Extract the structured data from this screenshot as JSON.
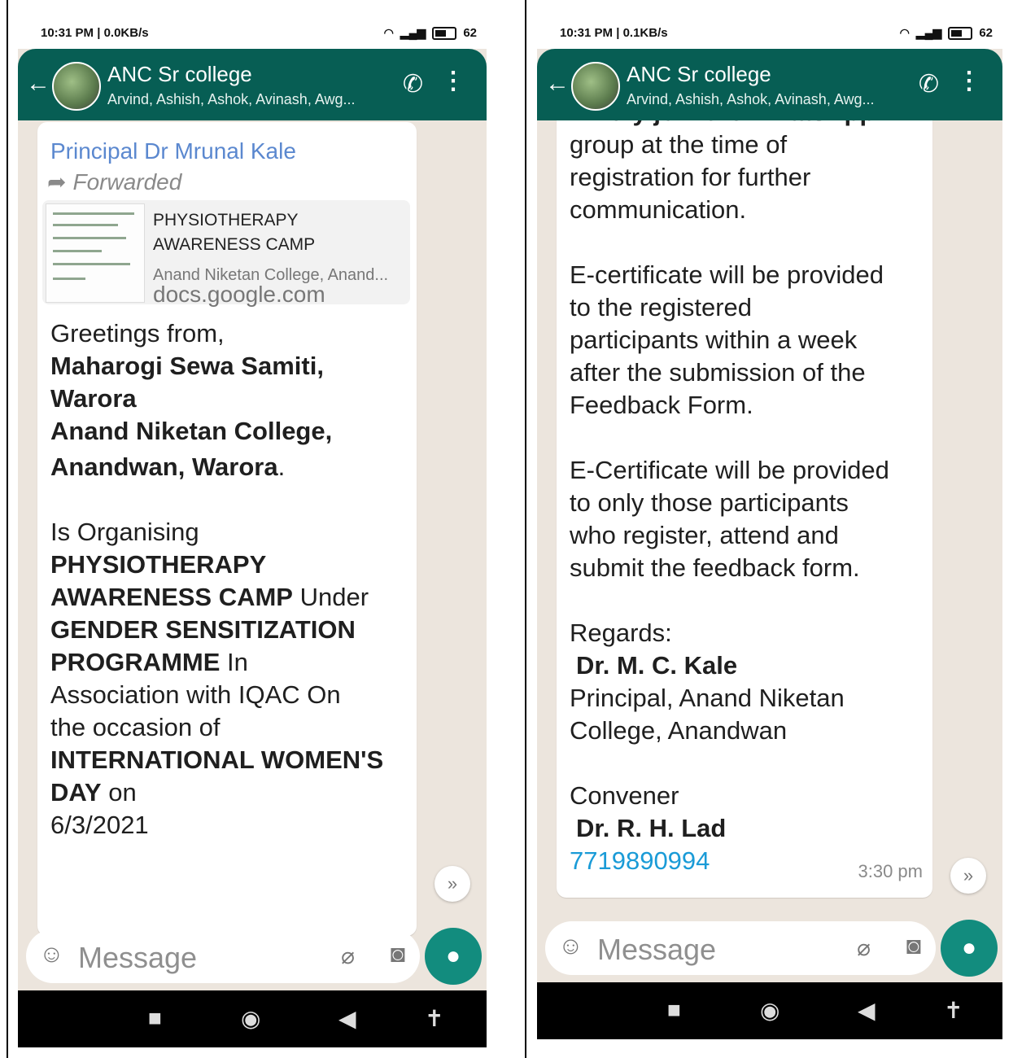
{
  "screens": [
    {
      "status": {
        "time_speed": "10:31 PM | 0.0KB/s",
        "battery": "62"
      },
      "header": {
        "title": "ANC Sr college",
        "subtitle": "Arvind, Ashish, Ashok, Avinash, Awg..."
      },
      "message": {
        "sender": "Principal Dr Mrunal Kale",
        "forwarded": "Forwarded",
        "link": {
          "title": "PHYSIOTHERAPY AWARENESS CAMP",
          "description": "Anand Niketan College, Anand...",
          "url": "docs.google.com"
        },
        "lines": {
          "l1": "Greetings from,",
          "l2": "Maharogi Sewa Samiti,",
          "l3": "Warora",
          "l4": "Anand Niketan College,",
          "l5": "Anandwan, Warora",
          "l5b": ".",
          "l6": "Is Organising",
          "l7": "PHYSIOTHERAPY",
          "l8a": "AWARENESS CAMP",
          "l8b": " Under",
          "l9": "GENDER SENSITIZATION",
          "l10a": "PROGRAMME",
          "l10b": " In",
          "l11": "Association with IQAC On",
          "l12": "the occasion of",
          "l13": "INTERNATIONAL WOMEN'S",
          "l14a": "DAY",
          "l14b": " on",
          "l15": "6/3/2021"
        }
      },
      "input": {
        "placeholder": "Message"
      }
    },
    {
      "status": {
        "time_speed": "10:31 PM | 0.1KB/s",
        "battery": "62"
      },
      "header": {
        "title": "ANC Sr college",
        "subtitle": "Arvind, Ashish, Ashok, Avinash, Awg..."
      },
      "message": {
        "lines": {
          "l0": "Kindly join the WhatsApp",
          "l1": "group at the time of",
          "l2": "registration for further",
          "l3": "communication.",
          "l4": "E-certificate will be provided",
          "l5": "to the registered",
          "l6": "participants within a week",
          "l7": "after the submission of the",
          "l8": "Feedback Form.",
          "l9": "E-Certificate will be provided",
          "l10": "to only those participants",
          "l11": "who register, attend and",
          "l12": "submit the feedback form.",
          "l13": "Regards:",
          "l14": "Dr. M. C. Kale",
          "l15": "Principal, Anand Niketan",
          "l16": "College, Anandwan",
          "l17": "Convener",
          "l18": "Dr. R. H. Lad",
          "phone": "7719890994",
          "time": "3:30 pm"
        }
      },
      "input": {
        "placeholder": "Message"
      }
    }
  ],
  "colors": {
    "header_green": "#075e54",
    "mic_green": "#128c7e",
    "sender_blue": "#5b88cf",
    "link_blue": "#1a9bd7"
  }
}
